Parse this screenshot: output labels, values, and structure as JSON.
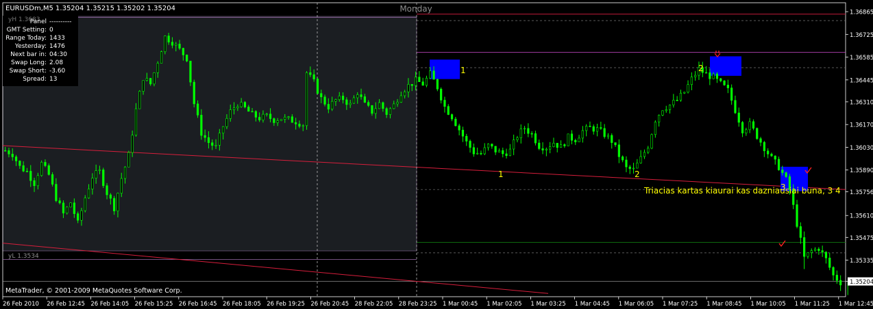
{
  "header": {
    "title": "EURUSDm,M5  1.35204 1.35215 1.35202 1.35204",
    "day_label": "Monday",
    "copyright": "MetaTrader, © 2001-2009 MetaQuotes Software Corp."
  },
  "panel": {
    "rows": [
      {
        "label": "Panel",
        "value": "----------"
      },
      {
        "label": "GMT Setting:",
        "value": "0"
      },
      {
        "label": "Range Today:",
        "value": "1433"
      },
      {
        "label": "Yesterday:",
        "value": "1476"
      },
      {
        "label": "Next bar in:",
        "value": "04:30"
      },
      {
        "label": "Swap Long:",
        "value": "2.08"
      },
      {
        "label": "Swap Short:",
        "value": "-3.60"
      },
      {
        "label": "Spread:",
        "value": "13"
      }
    ],
    "yh_label": "yH 1.3683",
    "yl_label": "yL 1.3534"
  },
  "colors": {
    "background": "#000000",
    "candles": "#00ff00",
    "shade": "#1b1e22",
    "price_label_bg": "#ffffff",
    "annotation": "#ffff00",
    "box": "#0000ff",
    "trendline": "#d81e3c",
    "purple_line": "#b040b0",
    "green_line": "#107a10",
    "arrow": "#ff2222"
  },
  "annotation_text": "Triacias kartas kiaurai kas dazniausiai buna, 3 4",
  "markers": [
    {
      "id": "box-1",
      "label": "1"
    },
    {
      "id": "box-2",
      "label": "2"
    },
    {
      "id": "box-3",
      "label": "3"
    },
    {
      "id": "low-1",
      "label": "1"
    },
    {
      "id": "low-2",
      "label": "2"
    }
  ],
  "chart_data": {
    "type": "candlestick",
    "symbol": "EURUSDm",
    "timeframe": "M5",
    "current_price": 1.35204,
    "ylim": [
      1.3511,
      1.3692
    ],
    "y_ticks": [
      1.36865,
      1.36725,
      1.36585,
      1.36445,
      1.3631,
      1.3617,
      1.3603,
      1.3589,
      1.35756,
      1.3561,
      1.35475,
      1.35335,
      1.35204
    ],
    "y_tick_labels": [
      "1.36865",
      "1.36725",
      "1.36585",
      "1.36445",
      "1.36310",
      "1.36170",
      "1.36030",
      "1.35890",
      "1.35756",
      "1.35610",
      "1.35475",
      "1.35335",
      "1.35204"
    ],
    "x_tick_labels": [
      "26 Feb 2010",
      "26 Feb 12:45",
      "26 Feb 14:05",
      "26 Feb 15:25",
      "26 Feb 16:45",
      "26 Feb 18:05",
      "26 Feb 19:25",
      "26 Feb 20:45",
      "28 Feb 22:05",
      "28 Feb 23:25",
      "1 Mar 00:45",
      "1 Mar 02:05",
      "1 Mar 03:25",
      "1 Mar 04:45",
      "1 Mar 06:05",
      "1 Mar 07:25",
      "1 Mar 08:45",
      "1 Mar 10:05",
      "1 Mar 11:25",
      "1 Mar 12:45"
    ],
    "close_path": [
      [
        0,
        1.3601
      ],
      [
        2,
        1.3599
      ],
      [
        4,
        1.3591
      ],
      [
        6,
        1.3588
      ],
      [
        8,
        1.3581
      ],
      [
        10,
        1.3593
      ],
      [
        12,
        1.3586
      ],
      [
        14,
        1.3572
      ],
      [
        16,
        1.3562
      ],
      [
        18,
        1.3569
      ],
      [
        20,
        1.3556
      ],
      [
        22,
        1.3572
      ],
      [
        24,
        1.3585
      ],
      [
        26,
        1.3588
      ],
      [
        28,
        1.3575
      ],
      [
        30,
        1.3566
      ],
      [
        32,
        1.3584
      ],
      [
        34,
        1.3598
      ],
      [
        36,
        1.3626
      ],
      [
        38,
        1.3646
      ],
      [
        40,
        1.3642
      ],
      [
        42,
        1.3656
      ],
      [
        44,
        1.3671
      ],
      [
        46,
        1.3668
      ],
      [
        48,
        1.3663
      ],
      [
        50,
        1.3658
      ],
      [
        52,
        1.363
      ],
      [
        54,
        1.3612
      ],
      [
        56,
        1.3606
      ],
      [
        58,
        1.3603
      ],
      [
        60,
        1.3616
      ],
      [
        62,
        1.3625
      ],
      [
        64,
        1.363
      ],
      [
        66,
        1.3627
      ],
      [
        68,
        1.3623
      ],
      [
        70,
        1.3621
      ],
      [
        72,
        1.3622
      ],
      [
        74,
        1.362
      ],
      [
        76,
        1.3621
      ],
      [
        78,
        1.362
      ],
      [
        80,
        1.3619
      ],
      [
        82,
        1.3617
      ],
      [
        83,
        1.3649
      ],
      [
        85,
        1.3643
      ],
      [
        87,
        1.3633
      ],
      [
        89,
        1.3628
      ],
      [
        91,
        1.3632
      ],
      [
        93,
        1.3633
      ],
      [
        95,
        1.3629
      ],
      [
        97,
        1.3637
      ],
      [
        99,
        1.3629
      ],
      [
        101,
        1.3625
      ],
      [
        103,
        1.363
      ],
      [
        105,
        1.3624
      ],
      [
        107,
        1.3629
      ],
      [
        109,
        1.3637
      ],
      [
        111,
        1.3641
      ],
      [
        113,
        1.3644
      ],
      [
        115,
        1.3642
      ],
      [
        117,
        1.3648
      ],
      [
        119,
        1.364
      ],
      [
        121,
        1.3628
      ],
      [
        123,
        1.3622
      ],
      [
        125,
        1.3614
      ],
      [
        127,
        1.3606
      ],
      [
        129,
        1.36
      ],
      [
        131,
        1.3599
      ],
      [
        133,
        1.3604
      ],
      [
        135,
        1.3601
      ],
      [
        137,
        1.3599
      ],
      [
        139,
        1.3601
      ],
      [
        141,
        1.361
      ],
      [
        143,
        1.3615
      ],
      [
        145,
        1.3611
      ],
      [
        147,
        1.3604
      ],
      [
        149,
        1.3603
      ],
      [
        151,
        1.3606
      ],
      [
        153,
        1.3603
      ],
      [
        155,
        1.3609
      ],
      [
        157,
        1.3608
      ],
      [
        159,
        1.3613
      ],
      [
        161,
        1.3615
      ],
      [
        163,
        1.3614
      ],
      [
        165,
        1.3611
      ],
      [
        167,
        1.3607
      ],
      [
        169,
        1.3598
      ],
      [
        171,
        1.359
      ],
      [
        173,
        1.3589
      ],
      [
        175,
        1.3596
      ],
      [
        177,
        1.3604
      ],
      [
        179,
        1.362
      ],
      [
        181,
        1.3627
      ],
      [
        183,
        1.3629
      ],
      [
        185,
        1.3632
      ],
      [
        187,
        1.3637
      ],
      [
        189,
        1.3645
      ],
      [
        191,
        1.3651
      ],
      [
        193,
        1.3648
      ],
      [
        195,
        1.3646
      ],
      [
        197,
        1.3642
      ],
      [
        199,
        1.3638
      ],
      [
        201,
        1.3626
      ],
      [
        203,
        1.3614
      ],
      [
        205,
        1.3617
      ],
      [
        207,
        1.361
      ],
      [
        209,
        1.3603
      ],
      [
        211,
        1.3596
      ],
      [
        213,
        1.3591
      ],
      [
        215,
        1.3583
      ],
      [
        216,
        1.3577
      ],
      [
        218,
        1.3556
      ],
      [
        220,
        1.3535
      ],
      [
        222,
        1.3539
      ],
      [
        224,
        1.3541
      ],
      [
        226,
        1.3534
      ],
      [
        228,
        1.3524
      ],
      [
        230,
        1.352
      ]
    ],
    "horizontal_levels": [
      {
        "name": "yH",
        "value": 1.3683
      },
      {
        "name": "yL",
        "value": 1.3534
      }
    ]
  }
}
